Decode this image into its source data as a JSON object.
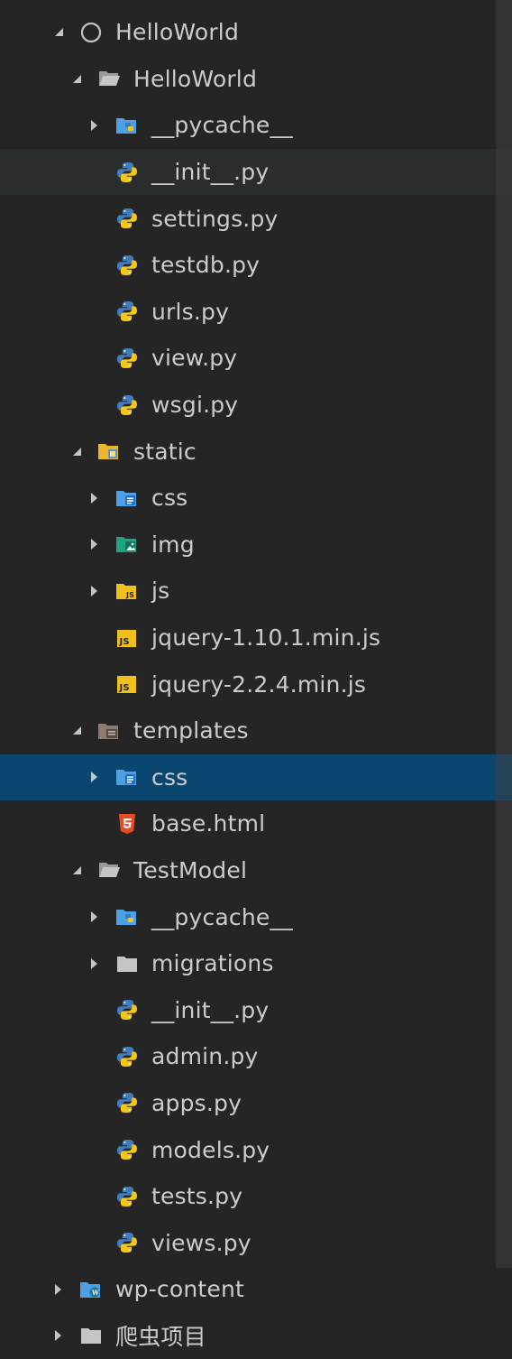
{
  "colors": {
    "background": "#252526",
    "selected_row": "#094771",
    "hover_row": "#2a2d2e",
    "text": "#cccccc",
    "scrollbar": "#3e3e42"
  },
  "tree": [
    {
      "label": "HelloWorld",
      "icon": "workspace-ring-icon",
      "arrow": "expanded",
      "depth": 0
    },
    {
      "label": "HelloWorld",
      "icon": "folder-open-icon",
      "arrow": "expanded",
      "depth": 1
    },
    {
      "label": "__pycache__",
      "icon": "folder-python-icon",
      "arrow": "collapsed",
      "depth": 2
    },
    {
      "label": "__init__.py",
      "icon": "python-file-icon",
      "arrow": "none",
      "depth": 2,
      "state": "hover"
    },
    {
      "label": "settings.py",
      "icon": "python-file-icon",
      "arrow": "none",
      "depth": 2
    },
    {
      "label": "testdb.py",
      "icon": "python-file-icon",
      "arrow": "none",
      "depth": 2
    },
    {
      "label": "urls.py",
      "icon": "python-file-icon",
      "arrow": "none",
      "depth": 2
    },
    {
      "label": "view.py",
      "icon": "python-file-icon",
      "arrow": "none",
      "depth": 2
    },
    {
      "label": "wsgi.py",
      "icon": "python-file-icon",
      "arrow": "none",
      "depth": 2
    },
    {
      "label": "static",
      "icon": "folder-static-icon",
      "arrow": "expanded",
      "depth": 1
    },
    {
      "label": "css",
      "icon": "folder-css-icon",
      "arrow": "collapsed",
      "depth": 2
    },
    {
      "label": "img",
      "icon": "folder-images-icon",
      "arrow": "collapsed",
      "depth": 2
    },
    {
      "label": "js",
      "icon": "folder-js-icon",
      "arrow": "collapsed",
      "depth": 2
    },
    {
      "label": "jquery-1.10.1.min.js",
      "icon": "js-file-icon",
      "arrow": "none",
      "depth": 2
    },
    {
      "label": "jquery-2.2.4.min.js",
      "icon": "js-file-icon",
      "arrow": "none",
      "depth": 2
    },
    {
      "label": "templates",
      "icon": "folder-templates-icon",
      "arrow": "expanded",
      "depth": 1
    },
    {
      "label": "css",
      "icon": "folder-css-icon",
      "arrow": "collapsed",
      "depth": 2,
      "state": "selected"
    },
    {
      "label": "base.html",
      "icon": "html-file-icon",
      "arrow": "none",
      "depth": 2
    },
    {
      "label": "TestModel",
      "icon": "folder-open-icon",
      "arrow": "expanded",
      "depth": 1
    },
    {
      "label": "__pycache__",
      "icon": "folder-python-icon",
      "arrow": "collapsed",
      "depth": 2
    },
    {
      "label": "migrations",
      "icon": "folder-closed-icon",
      "arrow": "collapsed",
      "depth": 2
    },
    {
      "label": "__init__.py",
      "icon": "python-file-icon",
      "arrow": "none",
      "depth": 2
    },
    {
      "label": "admin.py",
      "icon": "python-file-icon",
      "arrow": "none",
      "depth": 2
    },
    {
      "label": "apps.py",
      "icon": "python-file-icon",
      "arrow": "none",
      "depth": 2
    },
    {
      "label": "models.py",
      "icon": "python-file-icon",
      "arrow": "none",
      "depth": 2
    },
    {
      "label": "tests.py",
      "icon": "python-file-icon",
      "arrow": "none",
      "depth": 2
    },
    {
      "label": "views.py",
      "icon": "python-file-icon",
      "arrow": "none",
      "depth": 2
    },
    {
      "label": "wp-content",
      "icon": "folder-wordpress-icon",
      "arrow": "collapsed",
      "depth": 0
    },
    {
      "label": "爬虫项目",
      "icon": "folder-closed-icon",
      "arrow": "collapsed",
      "depth": 0
    }
  ]
}
